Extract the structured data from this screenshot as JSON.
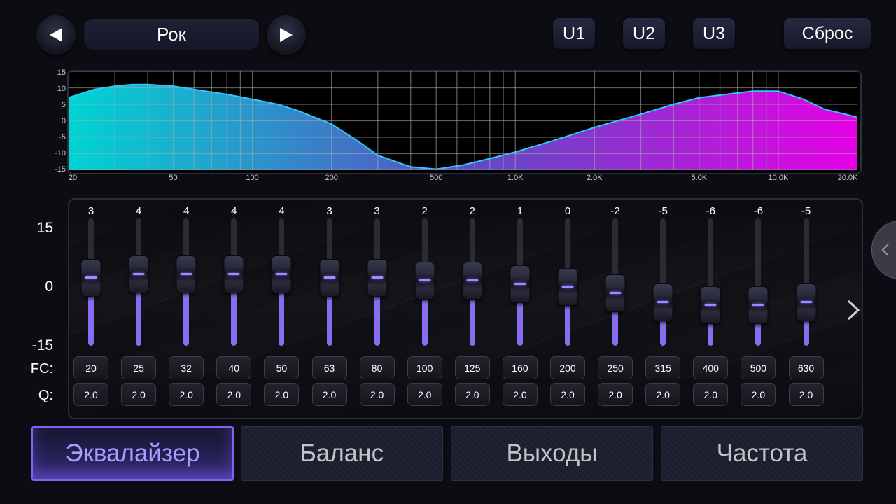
{
  "header": {
    "preset_name": "Рок",
    "user_presets": [
      "U1",
      "U2",
      "U3"
    ],
    "reset_label": "Сброс"
  },
  "response_graph": {
    "y_ticks": [
      "15",
      "10",
      "5",
      "0",
      "-5",
      "-10",
      "-15"
    ],
    "x_ticks": [
      "20",
      "50",
      "100",
      "200",
      "500",
      "1.0K",
      "2.0K",
      "5.0K",
      "10.0K",
      "20.0K"
    ],
    "curve_db": [
      [
        20,
        7
      ],
      [
        25,
        9.5
      ],
      [
        30,
        10.5
      ],
      [
        35,
        11
      ],
      [
        40,
        11
      ],
      [
        50,
        10.5
      ],
      [
        60,
        9.5
      ],
      [
        80,
        8
      ],
      [
        100,
        6.5
      ],
      [
        125,
        5
      ],
      [
        150,
        3
      ],
      [
        200,
        -1
      ],
      [
        250,
        -6
      ],
      [
        300,
        -10.5
      ],
      [
        400,
        -14
      ],
      [
        500,
        -14.7
      ],
      [
        630,
        -13.5
      ],
      [
        800,
        -11.5
      ],
      [
        1000,
        -9.5
      ],
      [
        1400,
        -6
      ],
      [
        2000,
        -2
      ],
      [
        3000,
        2
      ],
      [
        4000,
        5
      ],
      [
        5000,
        7
      ],
      [
        6300,
        8
      ],
      [
        8000,
        9
      ],
      [
        10000,
        9
      ],
      [
        12500,
        6.5
      ],
      [
        15000,
        3.5
      ],
      [
        18000,
        2
      ],
      [
        20000,
        1
      ]
    ],
    "colors": {
      "low": "#00d4d4",
      "mid": "#5a4ec2",
      "high": "#e600e6",
      "line": "#2ec8ff"
    }
  },
  "equalizer": {
    "scale_labels": [
      "15",
      "0",
      "-15"
    ],
    "fc_label": "FC:",
    "q_label": "Q:",
    "bands": [
      {
        "value": "3",
        "gain": 3,
        "fc": "20",
        "q": "2.0"
      },
      {
        "value": "4",
        "gain": 4,
        "fc": "25",
        "q": "2.0"
      },
      {
        "value": "4",
        "gain": 4,
        "fc": "32",
        "q": "2.0"
      },
      {
        "value": "4",
        "gain": 4,
        "fc": "40",
        "q": "2.0"
      },
      {
        "value": "4",
        "gain": 4,
        "fc": "50",
        "q": "2.0"
      },
      {
        "value": "3",
        "gain": 3,
        "fc": "63",
        "q": "2.0"
      },
      {
        "value": "3",
        "gain": 3,
        "fc": "80",
        "q": "2.0"
      },
      {
        "value": "2",
        "gain": 2,
        "fc": "100",
        "q": "2.0"
      },
      {
        "value": "2",
        "gain": 2,
        "fc": "125",
        "q": "2.0"
      },
      {
        "value": "1",
        "gain": 1,
        "fc": "160",
        "q": "2.0"
      },
      {
        "value": "0",
        "gain": 0,
        "fc": "200",
        "q": "2.0"
      },
      {
        "value": "-2",
        "gain": -2,
        "fc": "250",
        "q": "2.0"
      },
      {
        "value": "-5",
        "gain": -5,
        "fc": "315",
        "q": "2.0"
      },
      {
        "value": "-6",
        "gain": -6,
        "fc": "400",
        "q": "2.0"
      },
      {
        "value": "-6",
        "gain": -6,
        "fc": "500",
        "q": "2.0"
      },
      {
        "value": "-5",
        "gain": -5,
        "fc": "630",
        "q": "2.0"
      }
    ]
  },
  "tabs": [
    {
      "label": "Эквалайзер",
      "active": true
    },
    {
      "label": "Баланс",
      "active": false
    },
    {
      "label": "Выходы",
      "active": false
    },
    {
      "label": "Частота",
      "active": false
    }
  ],
  "icons": {
    "prev": "triangle-left-icon",
    "next": "triangle-right-icon",
    "side_panel": "chevron-left-icon",
    "more_bands": "chevron-right-icon"
  },
  "accent_color": "#8a6cf0"
}
